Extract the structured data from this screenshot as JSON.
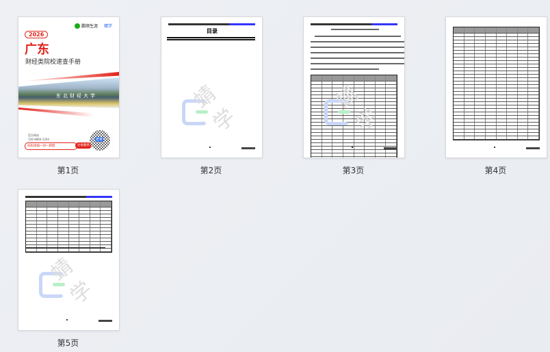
{
  "pages": [
    {
      "label": "第1页"
    },
    {
      "label": "第2页"
    },
    {
      "label": "第3页"
    },
    {
      "label": "第4页"
    },
    {
      "label": "第5页"
    }
  ],
  "cover": {
    "brand1": "鹏顺生涯",
    "brand2": "蜻学",
    "year": "2026",
    "region": "广东",
    "subtitle": "财经类院校速查手册",
    "banner": "东北财经大学",
    "website_label": "官方网站",
    "phone_label": "咨询电话",
    "phone": "156-9866-1204",
    "scan_text": "扫码添加一对一获取",
    "scan_btn": "分省服务",
    "qr_label": "老吴"
  },
  "toc": {
    "title": "目录"
  },
  "watermark": "蜻学",
  "colors": {
    "accent": "#e2231a",
    "brand_green": "#1aad19",
    "brand_blue": "#2a6df4"
  }
}
